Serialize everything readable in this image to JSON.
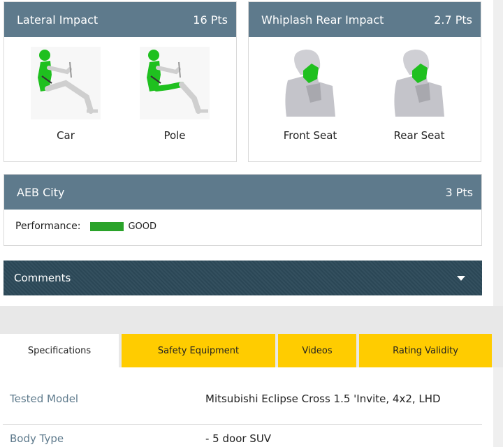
{
  "lateral": {
    "title": "Lateral Impact",
    "points": "16 Pts",
    "figures": [
      {
        "label": "Car",
        "icon": "crash-dummy-icon"
      },
      {
        "label": "Pole",
        "icon": "crash-dummy-icon"
      }
    ]
  },
  "whiplash": {
    "title": "Whiplash Rear Impact",
    "points": "2.7 Pts",
    "figures": [
      {
        "label": "Front Seat",
        "icon": "seat-headrest-icon"
      },
      {
        "label": "Rear Seat",
        "icon": "seat-headrest-icon"
      }
    ]
  },
  "aeb": {
    "title": "AEB City",
    "points": "3 Pts",
    "performance_label": "Performance:",
    "performance_value": "GOOD",
    "performance_color": "#2aa32a"
  },
  "comments": {
    "label": "Comments",
    "icon": "chevron-down-icon"
  },
  "tabs": [
    {
      "label": "Specifications",
      "active": true
    },
    {
      "label": "Safety Equipment"
    },
    {
      "label": "Videos"
    },
    {
      "label": "Rating Validity"
    }
  ],
  "specs": [
    {
      "key": "Tested Model",
      "value": "Mitsubishi Eclipse Cross 1.5 'Invite, 4x2, LHD"
    },
    {
      "key": "Body Type",
      "value": "- 5 door SUV"
    }
  ],
  "colors": {
    "header": "#5e7a8c",
    "comments_bg": "#2d4a5a",
    "tab_yellow": "#ffcc00",
    "good_green": "#2aa32a",
    "dummy_green": "#1fc01f"
  }
}
